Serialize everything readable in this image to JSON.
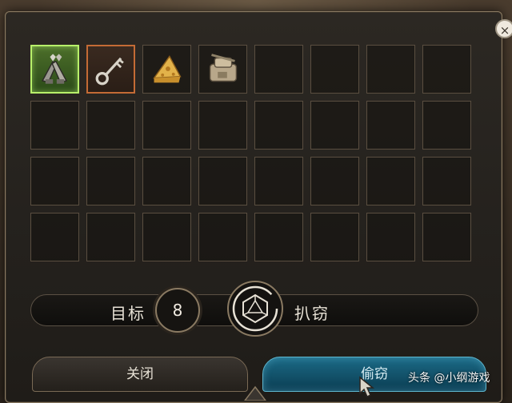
{
  "dialog": {
    "close_glyph": "×",
    "inventory": {
      "items": [
        {
          "slot": 1,
          "name": "gloves",
          "icon": "gloves-icon",
          "highlight": "#b8f06a"
        },
        {
          "slot": 2,
          "name": "key",
          "icon": "key-icon",
          "highlight": "#c46b35"
        },
        {
          "slot": 3,
          "name": "cheese",
          "icon": "cheese-icon"
        },
        {
          "slot": 4,
          "name": "bag",
          "icon": "pack-icon"
        }
      ],
      "columns": 8,
      "rows": 4
    },
    "check": {
      "target_label": "目标",
      "target_value": "8",
      "dice_icon": "d20-icon",
      "skill_label": "扒窃"
    },
    "buttons": {
      "close_label": "关闭",
      "steal_label": "偷窃"
    },
    "watermark": "头条 @小纲游戏"
  },
  "colors": {
    "primary_button": "#1b6a86",
    "selected_slot": "#b8f06a",
    "key_slot": "#c46b35"
  }
}
